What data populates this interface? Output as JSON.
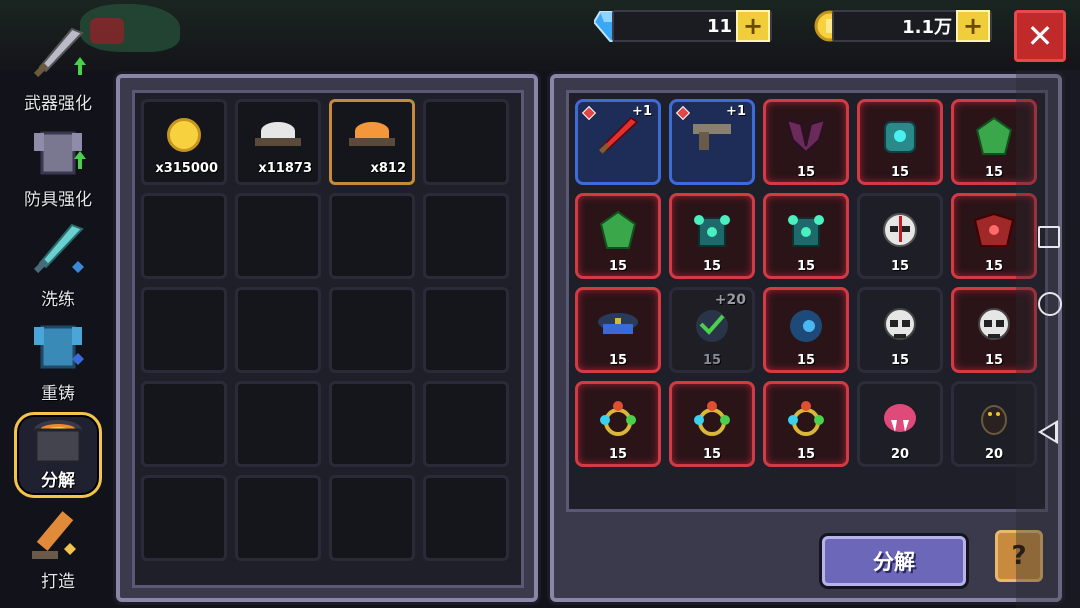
{
  "resources": {
    "gems": {
      "value": "11",
      "icon": "gem-icon"
    },
    "coins": {
      "value": "1.1万",
      "icon": "coin-icon"
    },
    "plus_label": "+",
    "close_label": "✕"
  },
  "side_menu": [
    {
      "label": "武器强化",
      "icon": "sword-upgrade-icon"
    },
    {
      "label": "防具强化",
      "icon": "armor-upgrade-icon"
    },
    {
      "label": "洗练",
      "icon": "refine-sword-icon"
    },
    {
      "label": "重铸",
      "icon": "recast-armor-icon"
    },
    {
      "label": "分解",
      "icon": "furnace-icon",
      "active": true
    },
    {
      "label": "打造",
      "icon": "forge-icon"
    }
  ],
  "materials": [
    {
      "name": "coin",
      "qty": "x315000",
      "icon": "gold-coin-icon"
    },
    {
      "name": "white-dust",
      "qty": "x11873",
      "icon": "white-dust-pile-icon"
    },
    {
      "name": "orange-dust",
      "qty": "x812",
      "icon": "orange-dust-pile-icon",
      "selected": true
    }
  ],
  "equipment": [
    {
      "icon": "red-sword-icon",
      "style": "blue",
      "plus": "+1",
      "tag": true
    },
    {
      "icon": "pistol-icon",
      "style": "blue",
      "plus": "+1",
      "tag": true
    },
    {
      "icon": "dark-armor-icon",
      "style": "red",
      "level": "15"
    },
    {
      "icon": "teal-armor-icon",
      "style": "red",
      "level": "15"
    },
    {
      "icon": "green-armor-icon",
      "style": "red",
      "level": "15"
    },
    {
      "icon": "green-armor-icon",
      "style": "red",
      "level": "15"
    },
    {
      "icon": "teal-chest-armor-icon",
      "style": "red",
      "level": "15"
    },
    {
      "icon": "teal-chest-armor-icon",
      "style": "red",
      "level": "15"
    },
    {
      "icon": "white-skull-helmet-icon",
      "style": "plain",
      "level": "15"
    },
    {
      "icon": "red-demon-armor-icon",
      "style": "red",
      "level": "15"
    },
    {
      "icon": "police-cap-icon",
      "style": "red",
      "level": "15"
    },
    {
      "icon": "checked-hood-icon",
      "style": "dim",
      "level": "15",
      "plus": "+20"
    },
    {
      "icon": "blue-hood-icon",
      "style": "red",
      "level": "15"
    },
    {
      "icon": "skull-mask-icon",
      "style": "plain",
      "level": "15"
    },
    {
      "icon": "skull-mask-icon",
      "style": "red",
      "level": "15"
    },
    {
      "icon": "gem-ring-icon",
      "style": "red",
      "level": "15"
    },
    {
      "icon": "gem-ring-icon",
      "style": "red",
      "level": "15"
    },
    {
      "icon": "gem-ring-icon",
      "style": "red",
      "level": "15"
    },
    {
      "icon": "pink-fang-icon",
      "style": "plain",
      "level": "20"
    },
    {
      "icon": "black-bug-icon",
      "style": "plain",
      "level": "20"
    }
  ],
  "actions": {
    "decompose_label": "分解",
    "help_label": "?"
  },
  "colors": {
    "rare_border": "#d23a44",
    "weapon_border": "#3b6cd8",
    "selected_border": "#c68a3c",
    "button_bg": "#6c67b8"
  }
}
